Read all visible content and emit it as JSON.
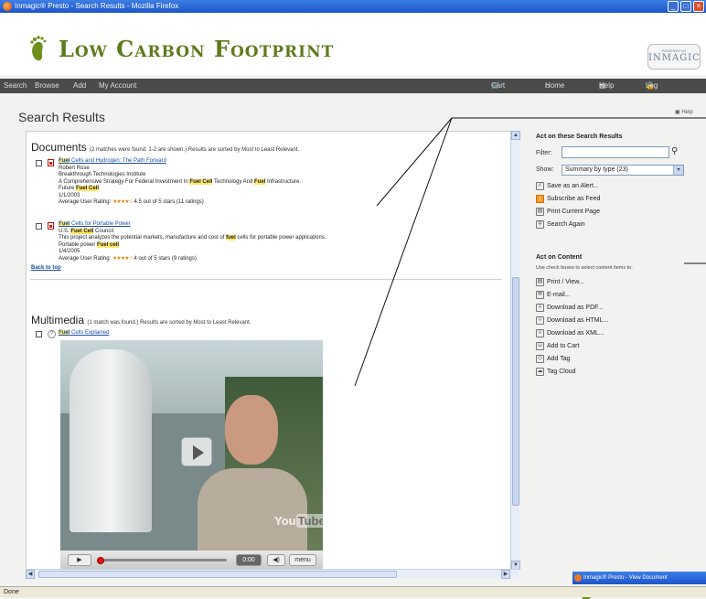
{
  "window": {
    "title": "Inmagic® Presto - Search Results - Mozilla Firefox"
  },
  "banner": {
    "logo_text": "Low Carbon Footprint",
    "powered_by": "POWERED BY",
    "vendor": "INMAGIC"
  },
  "nav": {
    "left": [
      "Search",
      "Browse",
      "Add",
      "My Account"
    ],
    "cart": "Cart (0)",
    "home": "Home",
    "help": "Help",
    "logout": "Log Out Phil"
  },
  "page": {
    "title": "Search Results",
    "help": "Help"
  },
  "documents": {
    "heading": "Documents",
    "summary": "(2 matches were found. 1-2 are shown.) Results are sorted by Most to Least Relevant.",
    "results": [
      {
        "title_hl": "Fuel",
        "title_rest": " Cells and Hydrogen: The Path Forward",
        "author": "Robert Rose",
        "org": "Breakthrough Technologies Institute",
        "desc_pre": "A Comprehensive Strategy For Federal Investment In ",
        "desc_hl1": "Fuel Cell",
        "desc_mid": " Technology And ",
        "desc_hl2": "Fuel",
        "desc_post": " Infrastructure.",
        "extra_pre": "Future ",
        "extra_hl": "Fuel Cell",
        "date": "1/1/2003",
        "rating_label": "Average User Rating:",
        "rating_text": "4.5 out of 5 stars (11 ratings)",
        "rating_value": 4.5
      },
      {
        "title_hl": "Fuel",
        "title_rest": " Cells for Portable Power",
        "author_pre": "U.S. ",
        "author_hl": "Fuel Cell",
        "author_post": " Council",
        "desc_pre": "This project analyzes the potential markets, manufacture and cost of ",
        "desc_hl": "fuel",
        "desc_post": " cells for portable power applications.",
        "extra_pre": "Portable power ",
        "extra_hl": "Fuel cell",
        "date": "1/4/2005",
        "rating_label": "Average User Rating:",
        "rating_text": "4 out of 5 stars (9 ratings)",
        "rating_value": 4
      }
    ],
    "back_to_top": "Back to top"
  },
  "multimedia": {
    "heading": "Multimedia",
    "summary": "(1 match was found.) Results are sorted by Most to Least Relevant.",
    "title_hl": "Fuel",
    "title_rest": " Cells Explained",
    "video": {
      "time": "0:00",
      "menu": "menu",
      "brand": "You",
      "brand2": "Tube"
    }
  },
  "sidebar": {
    "act_results_heading": "Act on these Search Results",
    "filter_label": "Filter:",
    "filter_value": "",
    "show_label": "Show:",
    "show_value": "Summary by type (23)",
    "result_actions": [
      {
        "label": "Save as an Alert...",
        "icon": "alert-icon"
      },
      {
        "label": "Subscribe as Feed",
        "icon": "rss-icon"
      },
      {
        "label": "Print Current Page",
        "icon": "print-icon"
      },
      {
        "label": "Search Again",
        "icon": "search-icon"
      }
    ],
    "act_content_heading": "Act on Content",
    "act_content_note": "Use check boxes to select content items to:",
    "content_actions": [
      {
        "label": "Print / View...",
        "icon": "print-icon"
      },
      {
        "label": "E-mail...",
        "icon": "email-icon"
      },
      {
        "label": "Download as PDF...",
        "icon": "download-icon"
      },
      {
        "label": "Download as HTML...",
        "icon": "download-icon"
      },
      {
        "label": "Download as XML...",
        "icon": "download-icon"
      },
      {
        "label": "Add to Cart",
        "icon": "cart-icon"
      },
      {
        "label": "Add Tag",
        "icon": "tag-icon"
      },
      {
        "label": "Tag Cloud",
        "icon": "tag-cloud-icon"
      }
    ]
  },
  "status": "Done",
  "ghost_window_title": "Inmagic® Presto - View Document"
}
